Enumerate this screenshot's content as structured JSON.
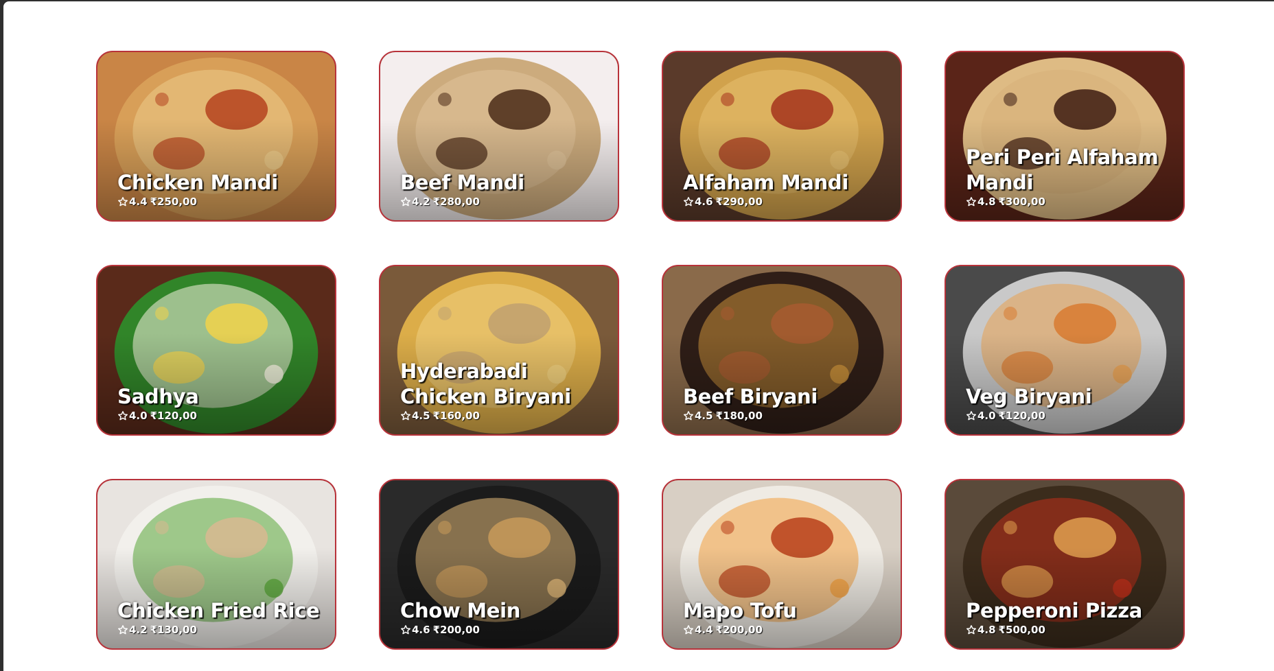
{
  "currency_symbol": "₹",
  "accent_color": "#b8323a",
  "rating_icon": "star-outline-icon",
  "menu": [
    {
      "name": "Chicken Mandi",
      "rating": "4.4",
      "price": "₹250,00",
      "palette": [
        "#c98546",
        "#d9a05a",
        "#b5431f",
        "#eccb8a"
      ]
    },
    {
      "name": "Beef Mandi",
      "rating": "4.2",
      "price": "₹280,00",
      "palette": [
        "#f4eeee",
        "#c9a676",
        "#4a2a17",
        "#e0c39a"
      ]
    },
    {
      "name": "Alfaham Mandi",
      "rating": "4.6",
      "price": "₹290,00",
      "palette": [
        "#5a3a2a",
        "#d8a84e",
        "#a5321c",
        "#e8c070"
      ]
    },
    {
      "name": "Peri Peri Alfaham Mandi",
      "rating": "4.8",
      "price": "₹300,00",
      "palette": [
        "#5a2418",
        "#e6c48a",
        "#3d1c12",
        "#d7b07a"
      ]
    },
    {
      "name": "Sadhya",
      "rating": "4.0",
      "price": "₹120,00",
      "palette": [
        "#5a2a1a",
        "#2f8a2a",
        "#f2d24a",
        "#f5f0e0"
      ]
    },
    {
      "name": "Hyderabadi Chicken Biryani",
      "rating": "4.5",
      "price": "₹160,00",
      "palette": [
        "#7a5a3a",
        "#e2b24a",
        "#c0a070",
        "#f0d080"
      ]
    },
    {
      "name": "Beef Biryani",
      "rating": "4.5",
      "price": "₹180,00",
      "palette": [
        "#8a6a4a",
        "#2a1a14",
        "#a85a30",
        "#c8903a"
      ]
    },
    {
      "name": "Veg Biryani",
      "rating": "4.0",
      "price": "₹120,00",
      "palette": [
        "#4a4a4a",
        "#d0d0d0",
        "#d87a30",
        "#e8a050"
      ]
    },
    {
      "name": "Chicken Fried Rice",
      "rating": "4.2",
      "price": "₹130,00",
      "palette": [
        "#e8e4e0",
        "#f2f0ec",
        "#d8b890",
        "#5aa83a"
      ]
    },
    {
      "name": "Chow Mein",
      "rating": "4.6",
      "price": "₹200,00",
      "palette": [
        "#2a2a2a",
        "#1a1a1a",
        "#c89a5a",
        "#e0b878"
      ]
    },
    {
      "name": "Mapo Tofu",
      "rating": "4.4",
      "price": "₹200,00",
      "palette": [
        "#d8cfc4",
        "#f0ece6",
        "#b8401a",
        "#f2a040"
      ]
    },
    {
      "name": "Pepperoni Pizza",
      "rating": "4.8",
      "price": "₹500,00",
      "palette": [
        "#5a4a3a",
        "#3a2a1a",
        "#e0a050",
        "#c0301a"
      ]
    }
  ]
}
